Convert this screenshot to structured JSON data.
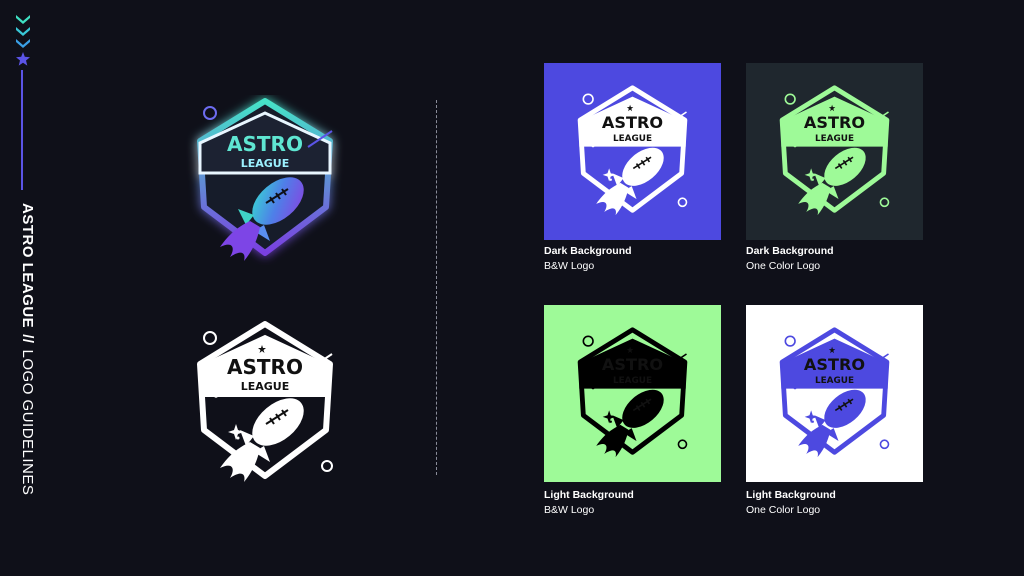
{
  "brand": {
    "name": "ASTRO LEAGUE",
    "separator": "//",
    "section": "LOGO GUIDELINES",
    "accent_color": "#5b54e6",
    "background_color": "#0f1019"
  },
  "side_icons": [
    "chevron-down-icon",
    "chevron-down-icon",
    "chevron-down-icon",
    "star-icon"
  ],
  "logo": {
    "word_top": "ASTRO",
    "word_bottom": "LEAGUE"
  },
  "variants": [
    {
      "heading": "Dark Background",
      "subheading": "B&W Logo",
      "background": "#4d49e0",
      "logo_color": "#ffffff"
    },
    {
      "heading": "Dark Background",
      "subheading": "One Color Logo",
      "background": "#1f272e",
      "logo_color": "#9efa98"
    },
    {
      "heading": "Light Background",
      "subheading": "B&W Logo",
      "background": "#9efa98",
      "logo_color": "#000000"
    },
    {
      "heading": "Light Background",
      "subheading": "One Color Logo",
      "background": "#ffffff",
      "logo_color": "#4d49e0"
    }
  ]
}
